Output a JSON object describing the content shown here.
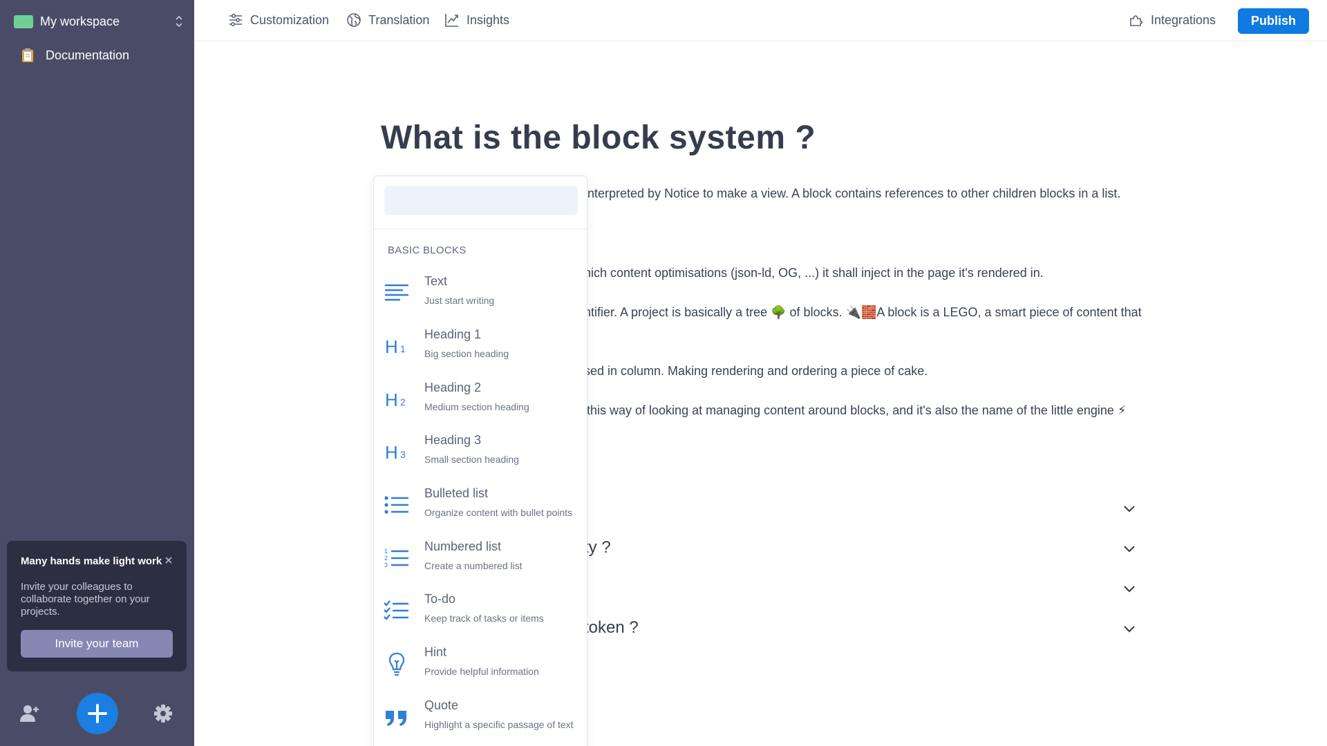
{
  "sidebar": {
    "workspace_name": "My workspace",
    "workspace_color": "#6fcf97",
    "item_documentation": "Documentation",
    "invite_card": {
      "title": "Many hands make light work",
      "text": "Invite your colleagues to collaborate together on your projects.",
      "button": "Invite your team"
    }
  },
  "topbar": {
    "customization": "Customization",
    "translation": "Translation",
    "insights": "Insights",
    "integrations": "Integrations",
    "publish": "Publish"
  },
  "document": {
    "title": "What is the block system ?",
    "paragraphs": [
      "nterpreted by Notice to make a view. A block contains references to other children blocks in a list.",
      "hich content optimisations (json-ld, OG, ...) it shall inject in the page it's rendered in.",
      "ntifier. A project is basically a tree 🌳 of blocks. 🔌🧱A block is a LEGO, a smart piece of content that",
      "sed in column. Making rendering and ordering a piece of cake.",
      "this way of looking at managing content around blocks, and it's also the name of the little engine ⚡"
    ],
    "faq": [
      "",
      "ty ?",
      "",
      "token ?"
    ]
  },
  "picker": {
    "search_placeholder": "",
    "section_label": "BASIC BLOCKS",
    "items": [
      {
        "title": "Text",
        "desc": "Just start writing",
        "icon": "text-icon"
      },
      {
        "title": "Heading 1",
        "desc": "Big section heading",
        "icon": "heading-1-icon"
      },
      {
        "title": "Heading 2",
        "desc": "Medium section heading",
        "icon": "heading-2-icon"
      },
      {
        "title": "Heading 3",
        "desc": "Small section heading",
        "icon": "heading-3-icon"
      },
      {
        "title": "Bulleted list",
        "desc": "Organize content with bullet points",
        "icon": "bulleted-list-icon"
      },
      {
        "title": "Numbered list",
        "desc": "Create a numbered list",
        "icon": "numbered-list-icon"
      },
      {
        "title": "To-do",
        "desc": "Keep track of tasks or items",
        "icon": "todo-icon"
      },
      {
        "title": "Hint",
        "desc": "Provide helpful information",
        "icon": "lightbulb-icon"
      },
      {
        "title": "Quote",
        "desc": "Highlight a specific passage of text",
        "icon": "quote-icon"
      }
    ]
  },
  "colors": {
    "sidebar_bg": "#4a4c67",
    "accent": "#0f7ae0",
    "icon_blue": "#2f7ed8"
  }
}
